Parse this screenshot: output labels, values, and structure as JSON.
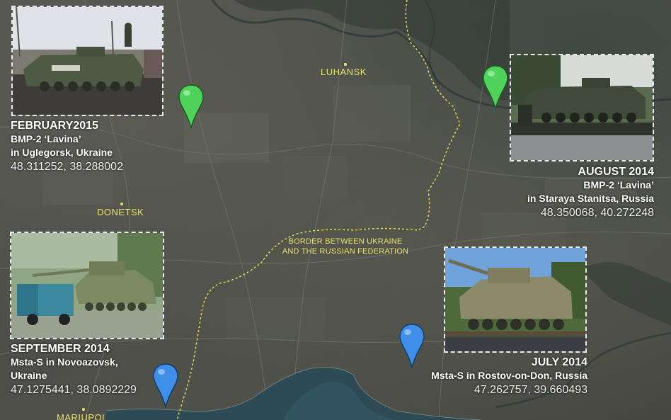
{
  "map": {
    "cities": [
      {
        "id": "luhansk",
        "label": "LUHANSK"
      },
      {
        "id": "donetsk",
        "label": "DONETSK"
      },
      {
        "id": "mariupol",
        "label": "MARIUPOL"
      }
    ],
    "border_label": [
      "BORDER BETWEEN UKRAINE",
      "AND THE RUSSIAN FEDERATION"
    ],
    "colors": {
      "border": "#e0d85a",
      "pin_green": "#4fd35a",
      "pin_blue": "#3f8fe8",
      "sea": "#2d4a55",
      "city_label": "#e8e36b"
    }
  },
  "markers": [
    {
      "id": "uglegorsk",
      "pin_color": "green",
      "date": "FEBRUARY2015",
      "lines": [
        "BMP-2 ‘Lavina’",
        "in Uglegorsk, Ukraine"
      ],
      "coords": "48.311252, 38.288002",
      "photo_icon": "bmp2-photo"
    },
    {
      "id": "staraya",
      "pin_color": "green",
      "date": "AUGUST 2014",
      "lines": [
        "BMP-2 ‘Lavina’",
        "in Staraya Stanitsa, Russia"
      ],
      "coords": "48.350068, 40.272248",
      "photo_icon": "bmp2-photo"
    },
    {
      "id": "novoazovsk",
      "pin_color": "blue",
      "date": "SEPTEMBER 2014",
      "lines": [
        "Msta-S in Novoazovsk,",
        "Ukraine"
      ],
      "coords": "47.1275441, 38.0892229",
      "photo_icon": "msta-s-photo"
    },
    {
      "id": "rostov",
      "pin_color": "blue",
      "date": "JULY 2014",
      "lines": [
        "Msta-S in Rostov-on-Don, Russia"
      ],
      "coords": "47.262757, 39.660493",
      "photo_icon": "msta-s-photo"
    }
  ]
}
